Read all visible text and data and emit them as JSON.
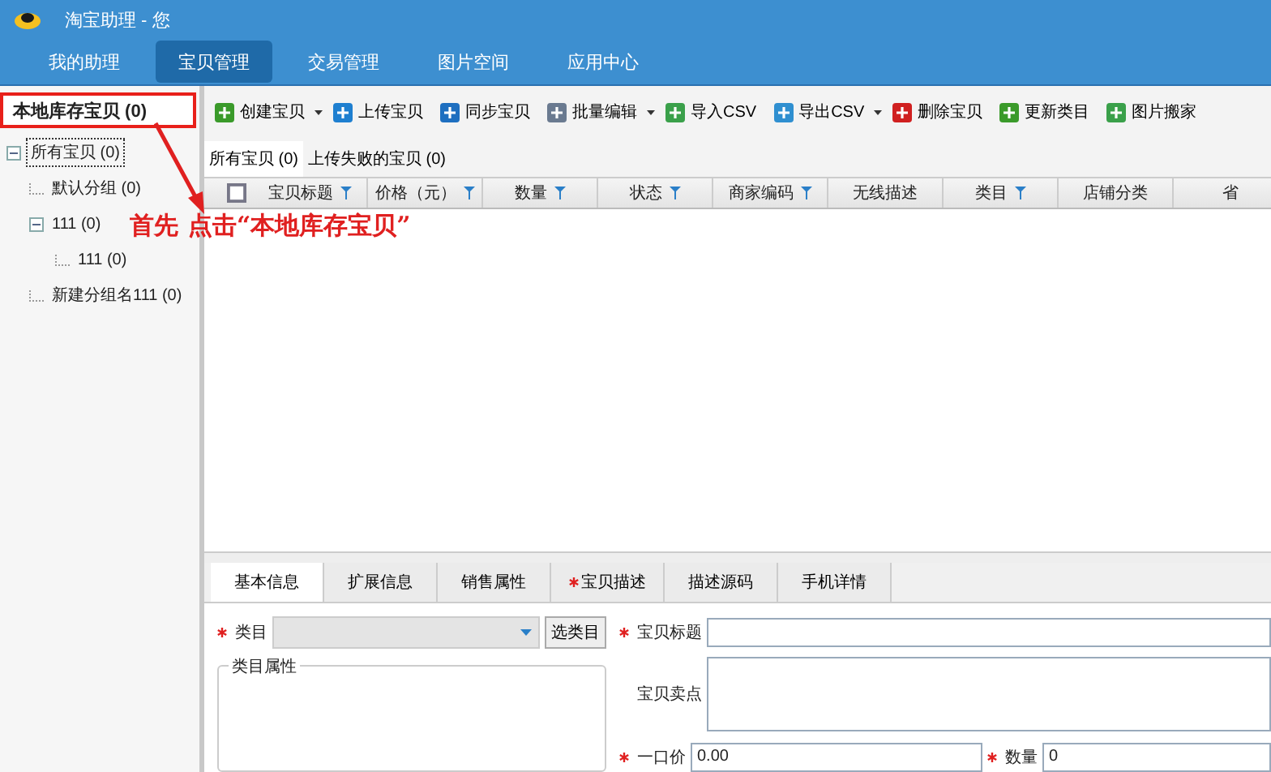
{
  "window": {
    "title": "淘宝助理 - 您"
  },
  "nav": {
    "items": [
      {
        "label": "我的助理",
        "selected": false
      },
      {
        "label": "宝贝管理",
        "selected": true
      },
      {
        "label": "交易管理",
        "selected": false
      },
      {
        "label": "图片空间",
        "selected": false
      },
      {
        "label": "应用中心",
        "selected": false
      }
    ]
  },
  "sidebar": {
    "header": {
      "label": "本地库存宝贝 (0)",
      "highlighted": true
    },
    "tree": [
      {
        "label": "所有宝贝 (0)",
        "selected": true,
        "expanded": true,
        "children": [
          {
            "label": "默认分组 (0)",
            "selected": false
          },
          {
            "label": "111 (0)",
            "selected": false,
            "expanded": true,
            "children": [
              {
                "label": "111 (0)",
                "selected": false
              }
            ]
          },
          {
            "label": "新建分组名111 (0)",
            "selected": false
          }
        ]
      }
    ]
  },
  "toolbar": {
    "buttons": [
      {
        "label": "创建宝贝",
        "dropdown": true
      },
      {
        "label": "上传宝贝",
        "dropdown": false
      },
      {
        "label": "同步宝贝",
        "dropdown": false
      },
      {
        "label": "批量编辑",
        "dropdown": true
      },
      {
        "label": "导入CSV",
        "dropdown": false
      },
      {
        "label": "导出CSV",
        "dropdown": true
      },
      {
        "label": "删除宝贝",
        "dropdown": false
      },
      {
        "label": "更新类目",
        "dropdown": false
      },
      {
        "label": "图片搬家",
        "dropdown": false
      }
    ]
  },
  "subtabs": [
    {
      "label": "所有宝贝 (0)",
      "selected": true
    },
    {
      "label": "上传失败的宝贝 (0)",
      "selected": false
    }
  ],
  "table": {
    "columns": [
      {
        "label": "宝贝标题",
        "filter": true
      },
      {
        "label": "价格（元）",
        "filter": true
      },
      {
        "label": "数量",
        "filter": true
      },
      {
        "label": "状态",
        "filter": true
      },
      {
        "label": "商家编码",
        "filter": true
      },
      {
        "label": "无线描述",
        "filter": false
      },
      {
        "label": "类目",
        "filter": true
      },
      {
        "label": "店铺分类",
        "filter": false
      },
      {
        "label": "省",
        "filter": false
      }
    ],
    "select_all": {
      "checked": false
    }
  },
  "annotation": {
    "step": "首先",
    "instruction": "点击“本地库存宝贝”"
  },
  "detail_tabs": [
    {
      "label": "基本信息",
      "selected": true,
      "required": false
    },
    {
      "label": "扩展信息",
      "selected": false,
      "required": false
    },
    {
      "label": "销售属性",
      "selected": false,
      "required": false
    },
    {
      "label": "宝贝描述",
      "selected": false,
      "required": true
    },
    {
      "label": "描述源码",
      "selected": false,
      "required": false
    },
    {
      "label": "手机详情",
      "selected": false,
      "required": false
    }
  ],
  "form": {
    "category": {
      "label": "类目",
      "required": true,
      "button": "选类目"
    },
    "category_attributes": {
      "label": "类目属性"
    },
    "title": {
      "label": "宝贝标题",
      "required": true
    },
    "selling_point": {
      "label": "宝贝卖点",
      "required": false
    },
    "price": {
      "label": "一口价",
      "required": true,
      "value": "0.00"
    },
    "quantity": {
      "label": "数量",
      "required": true,
      "value": "0"
    }
  }
}
